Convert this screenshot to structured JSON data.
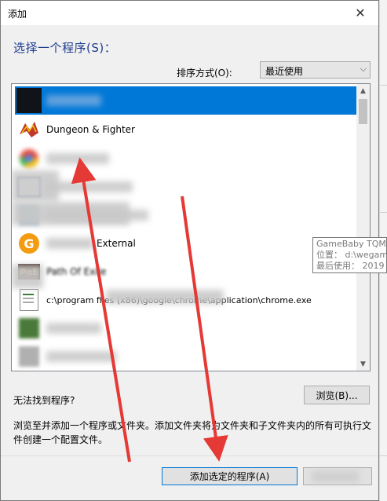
{
  "window": {
    "title": "添加"
  },
  "heading": "选择一个程序(S)：",
  "sort": {
    "label": "排序方式(O):",
    "selected": "最近使用"
  },
  "programs": [
    {
      "label": "",
      "icon": "dark-app-icon",
      "selected": true
    },
    {
      "label": "Dungeon & Fighter",
      "icon": "dnf-game-icon",
      "selected": false
    },
    {
      "label": "",
      "icon": "chrome-icon",
      "selected": false
    },
    {
      "label": "",
      "icon": "window-app-icon",
      "selected": false
    },
    {
      "label": "",
      "icon": "app-icon",
      "selected": false
    },
    {
      "label": "External",
      "icon": "gamebaby-icon",
      "selected": false
    },
    {
      "label": "Path Of Exile",
      "icon": "poe-game-icon",
      "selected": false
    },
    {
      "label": "c:\\program files (x86)\\google\\chrome\\application\\chrome.exe",
      "icon": "file-icon",
      "selected": false
    },
    {
      "label": "",
      "icon": "app-icon",
      "selected": false
    },
    {
      "label": "",
      "icon": "app-icon",
      "selected": false
    }
  ],
  "not_found_label": "无法找到程序?",
  "browse_label": "浏览(B)...",
  "description": "浏览至并添加一个程序或文件夹。添加文件夹将为文件夹和子文件夹内的所有可执行文件创建一个配置文件。",
  "add_button_label": "添加选定的程序(A)",
  "tooltip": {
    "line1": "GameBaby TQM",
    "line2": "位置： d:\\wegam",
    "line3": "最后使用： 2019"
  },
  "colors": {
    "selection": "#0078d7",
    "heading": "#1e3d8f",
    "annotation_arrow": "#e53935"
  }
}
